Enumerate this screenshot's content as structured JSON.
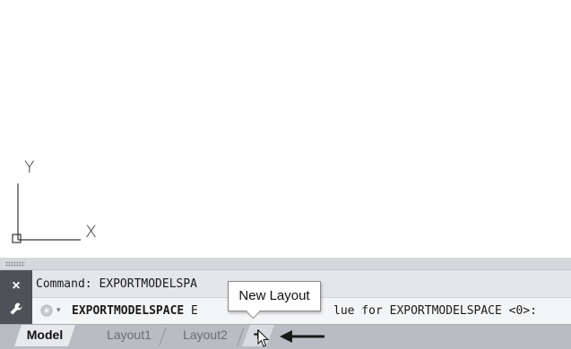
{
  "ucs": {
    "y_axis_label": "Y",
    "x_axis_label": "X"
  },
  "command_line": {
    "history_text": "Command: EXPORTMODELSPA",
    "prompt_command": "EXPORTMODELSPACE",
    "prompt_rest_visible": " E",
    "prompt_tail": "lue for EXPORTMODELSPACE <0>:",
    "close_glyph": "×",
    "customize_glyph": "🔧",
    "dropdown_glyph": "▾"
  },
  "tabs": {
    "model_label": "Model",
    "layout1_label": "Layout1",
    "layout2_label": "Layout2",
    "new_layout_glyph": "+"
  },
  "tooltip": {
    "text": "New Layout"
  },
  "colors": {
    "command_panel": "#c9ccd1",
    "side_strip": "#4e5258",
    "tab_strip": "#b9bdc3",
    "active_tab": "#e7e9ec"
  },
  "icons": {
    "close": "close-icon",
    "customize": "wrench-icon",
    "command_gear": "gear-icon",
    "pointer": "mouse-cursor-icon",
    "annotation_arrow": "left-arrow-icon"
  }
}
